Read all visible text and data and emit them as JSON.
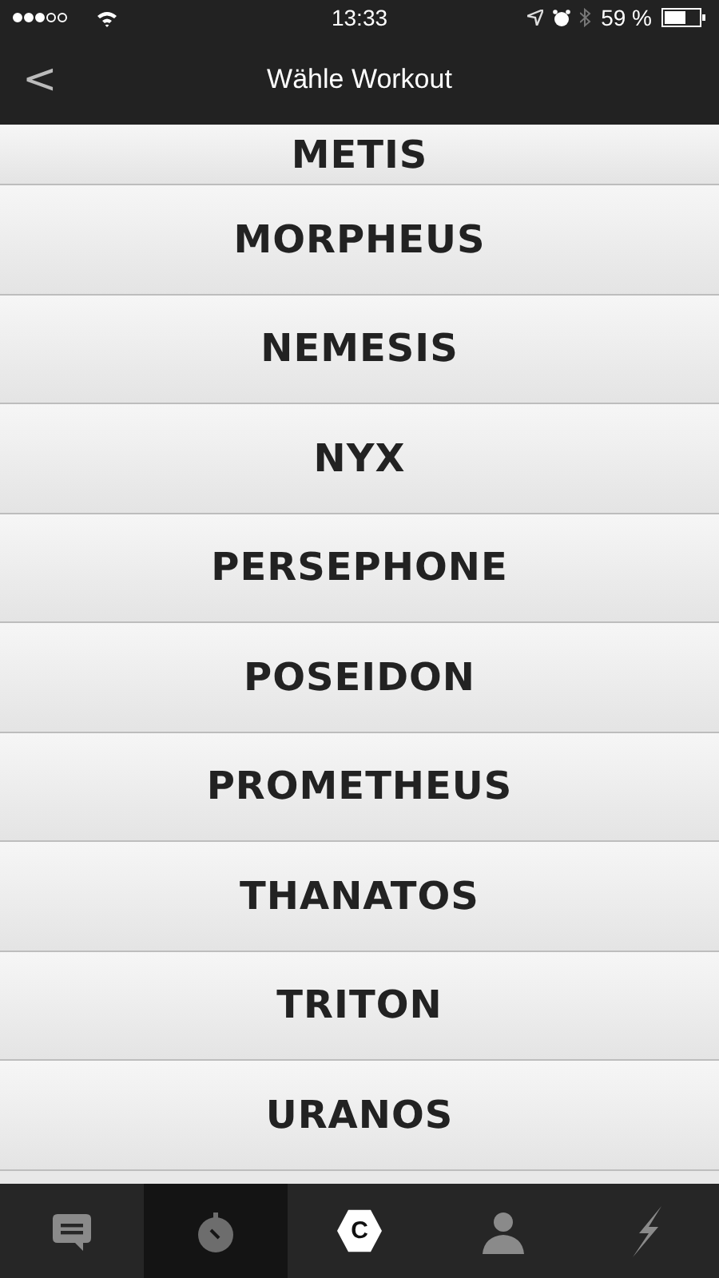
{
  "status_bar": {
    "time": "13:33",
    "battery": "59 %"
  },
  "nav_bar": {
    "back": "<",
    "title": "Wähle Workout"
  },
  "workouts": [
    {
      "name": "METIS"
    },
    {
      "name": "MORPHEUS"
    },
    {
      "name": "NEMESIS"
    },
    {
      "name": "NYX"
    },
    {
      "name": "PERSEPHONE"
    },
    {
      "name": "POSEIDON"
    },
    {
      "name": "PROMETHEUS"
    },
    {
      "name": "THANATOS"
    },
    {
      "name": "TRITON"
    },
    {
      "name": "URANOS"
    }
  ],
  "tab_bar": [
    {
      "kind": "chat",
      "selected": false
    },
    {
      "kind": "timer",
      "selected": true
    },
    {
      "kind": "badge",
      "label": "C",
      "selected": false
    },
    {
      "kind": "profile",
      "selected": false
    },
    {
      "kind": "bolt",
      "selected": false
    }
  ]
}
